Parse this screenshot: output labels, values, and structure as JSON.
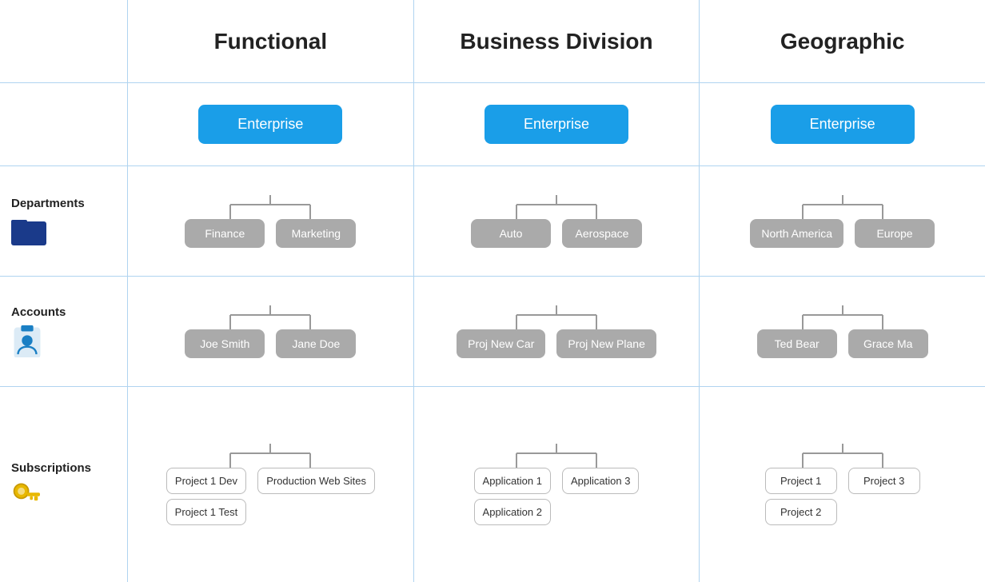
{
  "header": {
    "col1": "Functional",
    "col2": "Business Division",
    "col3": "Geographic"
  },
  "sidebar": {
    "departments": {
      "label": "Departments"
    },
    "accounts": {
      "label": "Accounts"
    },
    "subscriptions": {
      "label": "Subscriptions"
    }
  },
  "functional": {
    "root": "Enterprise",
    "departments": [
      "Finance",
      "Marketing"
    ],
    "accounts": [
      [
        "Joe Smith"
      ],
      [
        "Jane Doe"
      ]
    ],
    "subscriptions": [
      [
        "Project 1 Dev",
        "Project 1 Test"
      ],
      [
        "Production Web Sites"
      ]
    ]
  },
  "business": {
    "root": "Enterprise",
    "departments": [
      "Auto",
      "Aerospace"
    ],
    "accounts": [
      [
        "Proj New Car"
      ],
      [
        "Proj New Plane"
      ]
    ],
    "subscriptions": [
      [
        "Application 1",
        "Application 2"
      ],
      [
        "Application 3"
      ]
    ]
  },
  "geographic": {
    "root": "Enterprise",
    "departments": [
      "North America",
      "Europe"
    ],
    "accounts": [
      [
        "Ted Bear"
      ],
      [
        "Grace Ma"
      ]
    ],
    "subscriptions": [
      [
        "Project 1",
        "Project 2"
      ],
      [
        "Project 3"
      ]
    ]
  }
}
